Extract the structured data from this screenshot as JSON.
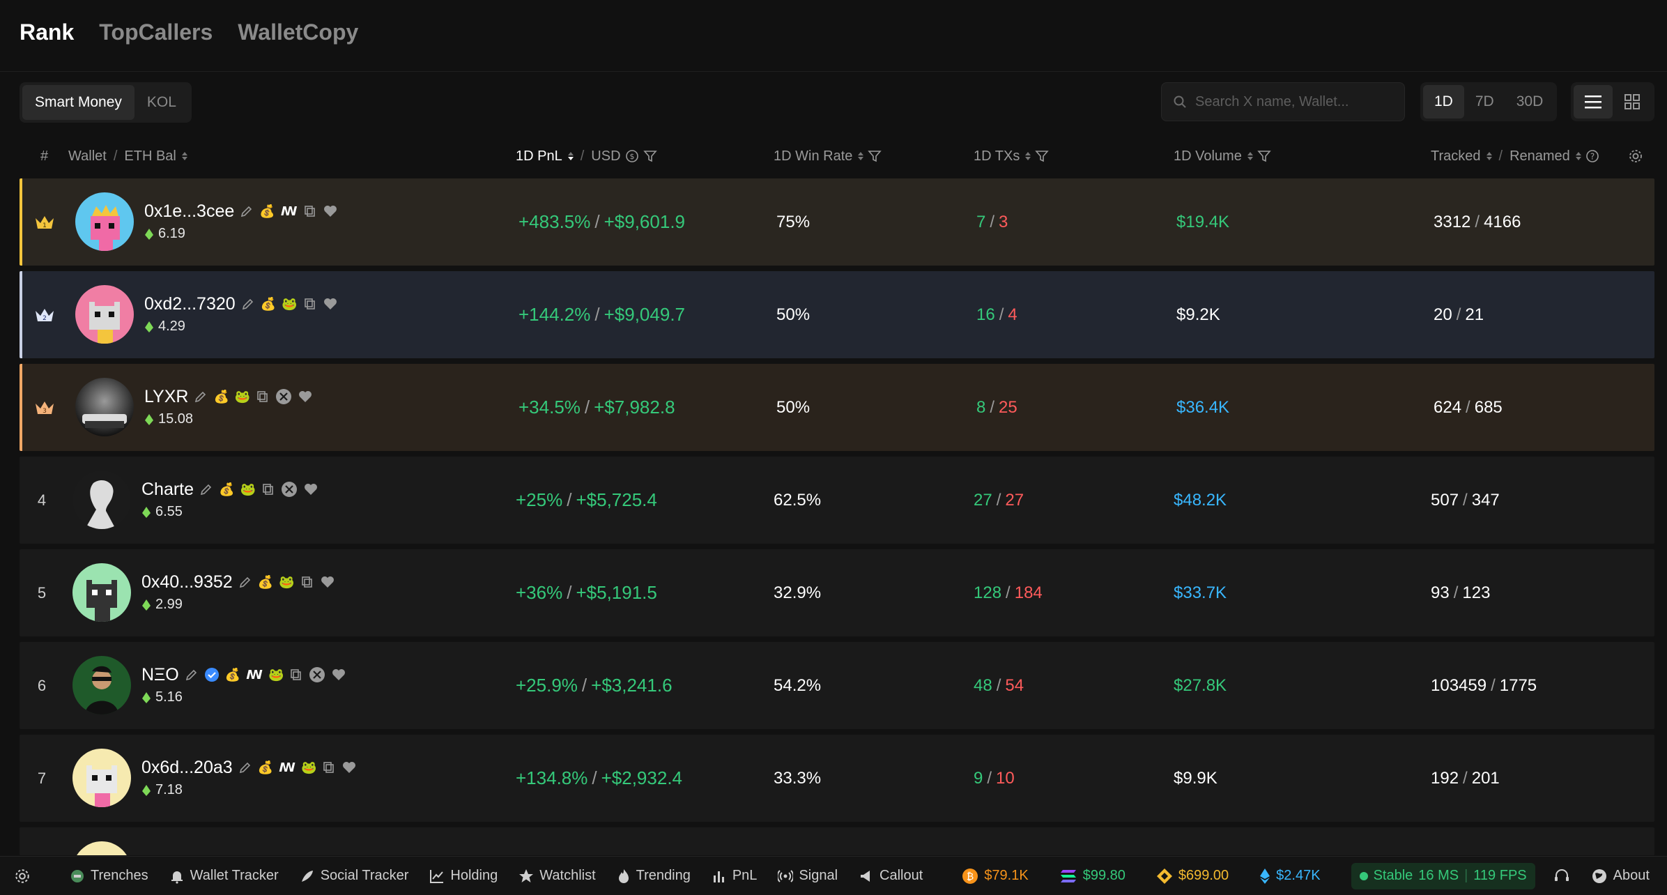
{
  "tabs": [
    "Rank",
    "TopCallers",
    "WalletCopy"
  ],
  "segment": [
    "Smart Money",
    "KOL"
  ],
  "search": {
    "placeholder": "Search X name, Wallet..."
  },
  "periods": [
    "1D",
    "7D",
    "30D"
  ],
  "columns": {
    "rank": "#",
    "wallet": "Wallet",
    "eth_bal": "ETH Bal",
    "pnl": "1D PnL",
    "usd": "USD",
    "win_rate": "1D Win Rate",
    "txs": "1D TXs",
    "volume": "1D Volume",
    "tracked": "Tracked",
    "renamed": "Renamed"
  },
  "rows": [
    {
      "rank": "1",
      "name": "0x1e...3cee",
      "bal": "6.19",
      "pnl_pct": "+483.5%",
      "pnl_usd": "+$9,601.9",
      "win": "75%",
      "tx_buy": "7",
      "tx_sell": "3",
      "volume": "$19.4K",
      "tracked": "3312",
      "renamed": "4166"
    },
    {
      "rank": "2",
      "name": "0xd2...7320",
      "bal": "4.29",
      "pnl_pct": "+144.2%",
      "pnl_usd": "+$9,049.7",
      "win": "50%",
      "tx_buy": "16",
      "tx_sell": "4",
      "volume": "$9.2K",
      "tracked": "20",
      "renamed": "21"
    },
    {
      "rank": "3",
      "name": "LYXR",
      "bal": "15.08",
      "pnl_pct": "+34.5%",
      "pnl_usd": "+$7,982.8",
      "win": "50%",
      "tx_buy": "8",
      "tx_sell": "25",
      "volume": "$36.4K",
      "tracked": "624",
      "renamed": "685"
    },
    {
      "rank": "4",
      "name": "Charte",
      "bal": "6.55",
      "pnl_pct": "+25%",
      "pnl_usd": "+$5,725.4",
      "win": "62.5%",
      "tx_buy": "27",
      "tx_sell": "27",
      "volume": "$48.2K",
      "tracked": "507",
      "renamed": "347"
    },
    {
      "rank": "5",
      "name": "0x40...9352",
      "bal": "2.99",
      "pnl_pct": "+36%",
      "pnl_usd": "+$5,191.5",
      "win": "32.9%",
      "tx_buy": "128",
      "tx_sell": "184",
      "volume": "$33.7K",
      "tracked": "93",
      "renamed": "123"
    },
    {
      "rank": "6",
      "name": "NΞO",
      "bal": "5.16",
      "pnl_pct": "+25.9%",
      "pnl_usd": "+$3,241.6",
      "win": "54.2%",
      "tx_buy": "48",
      "tx_sell": "54",
      "volume": "$27.8K",
      "tracked": "103459",
      "renamed": "1775"
    },
    {
      "rank": "7",
      "name": "0x6d...20a3",
      "bal": "7.18",
      "pnl_pct": "+134.8%",
      "pnl_usd": "+$2,932.4",
      "win": "33.3%",
      "tx_buy": "9",
      "tx_sell": "10",
      "volume": "$9.9K",
      "tracked": "192",
      "renamed": "201"
    }
  ],
  "bottom_nav": [
    "Trenches",
    "Wallet Tracker",
    "Social Tracker",
    "Holding",
    "Watchlist",
    "Trending",
    "PnL",
    "Signal",
    "Callout"
  ],
  "prices": {
    "btc": "$79.1K",
    "sol": "$99.80",
    "bnb": "$699.00",
    "eth": "$2.47K"
  },
  "status": {
    "label": "Stable",
    "ms": "16 MS",
    "fps": "119 FPS"
  },
  "about": "About"
}
